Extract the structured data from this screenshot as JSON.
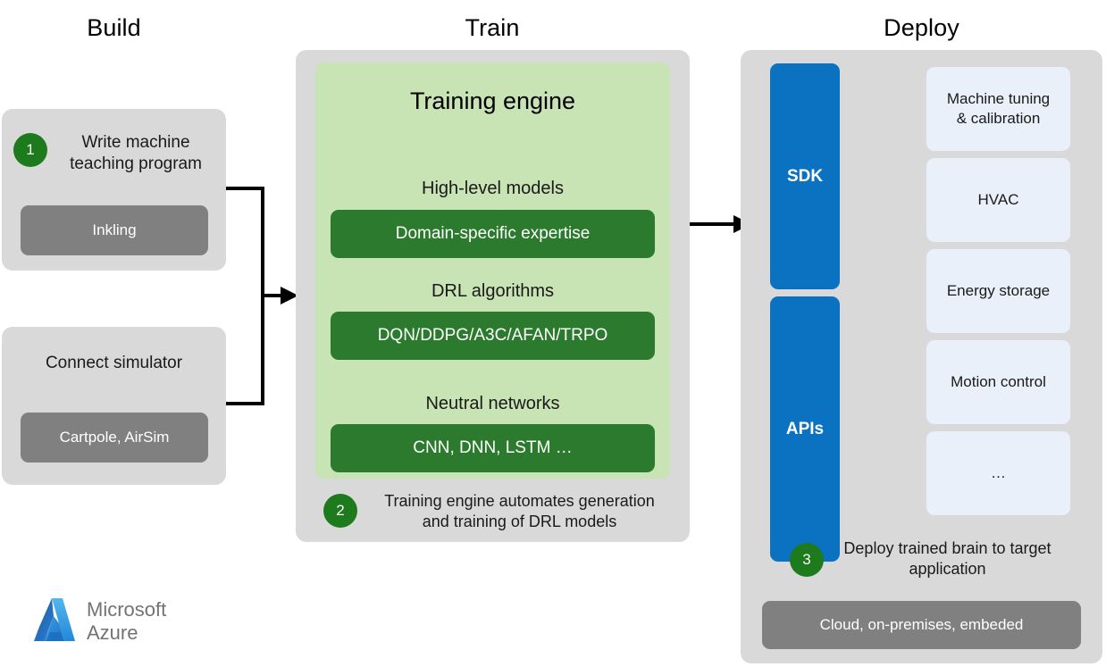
{
  "columns": {
    "build": {
      "title": "Build"
    },
    "train": {
      "title": "Train"
    },
    "deploy": {
      "title": "Deploy"
    }
  },
  "build": {
    "step1": {
      "number": "1",
      "text": "Write machine\nteaching program",
      "chip": "Inkling"
    },
    "simulator": {
      "title": "Connect simulator",
      "chip": "Cartpole, AirSim"
    }
  },
  "train": {
    "engine_title": "Training engine",
    "groups": [
      {
        "label": "High-level models",
        "chip": "Domain-specific expertise"
      },
      {
        "label": "DRL algorithms",
        "chip": "DQN/DDPG/A3C/AFAN/TRPO"
      },
      {
        "label": "Neutral networks",
        "chip": "CNN, DNN, LSTM …"
      }
    ],
    "step2": {
      "number": "2",
      "text": "Training engine automates generation\nand training of DRL models"
    }
  },
  "deploy": {
    "interfaces": [
      {
        "label": "SDK"
      },
      {
        "label": "APIs"
      }
    ],
    "targets": [
      {
        "label": "Machine tuning\n& calibration"
      },
      {
        "label": "HVAC"
      },
      {
        "label": "Energy storage"
      },
      {
        "label": "Motion control"
      },
      {
        "label": "…"
      }
    ],
    "step3": {
      "number": "3",
      "text": "Deploy trained brain to target\napplication"
    },
    "chip": "Cloud, on-premises, embeded"
  },
  "branding": {
    "line1": "Microsoft",
    "line2": "Azure"
  },
  "colors": {
    "panel_gray": "#d9d9d9",
    "chip_gray": "#808080",
    "green_panel": "#c8e3b4",
    "green_chip": "#2c7a2e",
    "step_green": "#1d7a1d",
    "blue": "#0a72c0",
    "card_blue": "#e9f0f9",
    "connector": "#000000"
  }
}
